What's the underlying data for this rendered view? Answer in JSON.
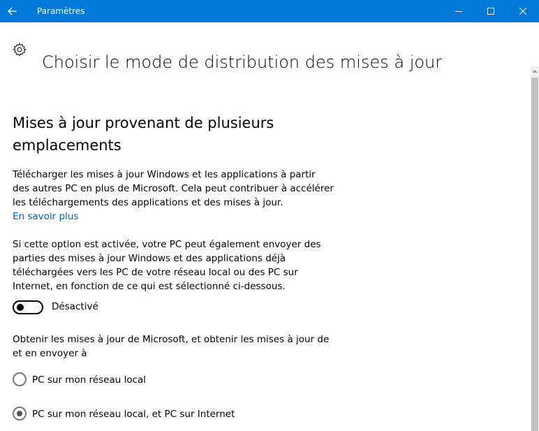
{
  "window": {
    "title": "Paramètres",
    "accent_color": "#0078d7"
  },
  "icons": {
    "back": "back-arrow-icon",
    "minimize": "minimize-icon",
    "maximize": "maximize-icon",
    "close": "close-icon",
    "settings": "gear-icon",
    "scroll_up": "chevron-up-icon"
  },
  "header": {
    "title": "Choisir le mode de distribution des mises à jour"
  },
  "section": {
    "title": "Mises à jour provenant de plusieurs emplacements",
    "description": "Télécharger les mises à jour Windows et les applications à partir des autres PC en plus de Microsoft. Cela peut contribuer à accélérer les téléchargements des applications et des mises à jour.",
    "link_label": "En savoir plus",
    "link_color": "#0063b1",
    "detail": "Si cette option est activée, votre PC peut également envoyer des parties des mises à jour Windows et des applications déjà téléchargées vers les PC de votre réseau local ou des PC sur Internet, en fonction de ce qui est sélectionné ci-dessous.",
    "toggle": {
      "state": "off",
      "label": "Désactivé"
    },
    "options_intro": "Obtenir les mises à jour de Microsoft, et obtenir les mises à jour de et en envoyer à",
    "options": [
      {
        "label": "PC sur mon réseau local",
        "selected": false
      },
      {
        "label": "PC sur mon réseau local, et PC sur Internet",
        "selected": true
      }
    ]
  }
}
